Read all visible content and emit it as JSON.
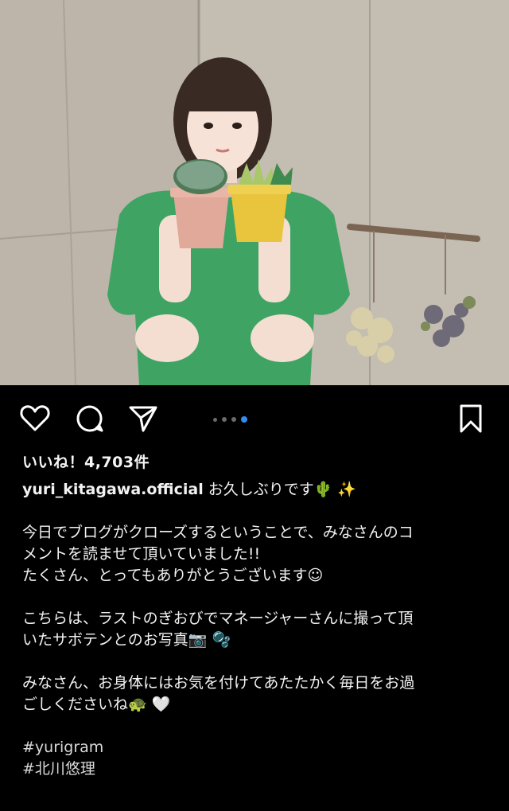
{
  "post": {
    "likes_text": "いいね！4,703件",
    "username": "yuri_kitagawa.official",
    "first_line": "お久しぶりです🌵 ✨",
    "paragraph1": [
      "今日でブログがクローズするということで、みなさんのコ",
      "メントを読ませて頂いていました!!",
      "たくさん、とってもありがとうございます☺"
    ],
    "paragraph2": [
      "こちらは、ラストのぎおびでマネージャーさんに撮って頂",
      "いたサボテンとのお写真📷 🫧"
    ],
    "paragraph3": [
      "みなさん、お身体にはお気を付けてあたたかく毎日をお過",
      "ごしくださいね🐢 🤍"
    ],
    "hashtags": [
      "#yurigram",
      "#北川悠理"
    ]
  },
  "carousel": {
    "total": 4,
    "active_index": 4
  },
  "icons": {
    "like": "heart-icon",
    "comment": "comment-icon",
    "share": "send-icon",
    "save": "bookmark-icon"
  },
  "colors": {
    "background": "#000000",
    "active_dot": "#2f8df5",
    "text": "#f5f5f5"
  }
}
